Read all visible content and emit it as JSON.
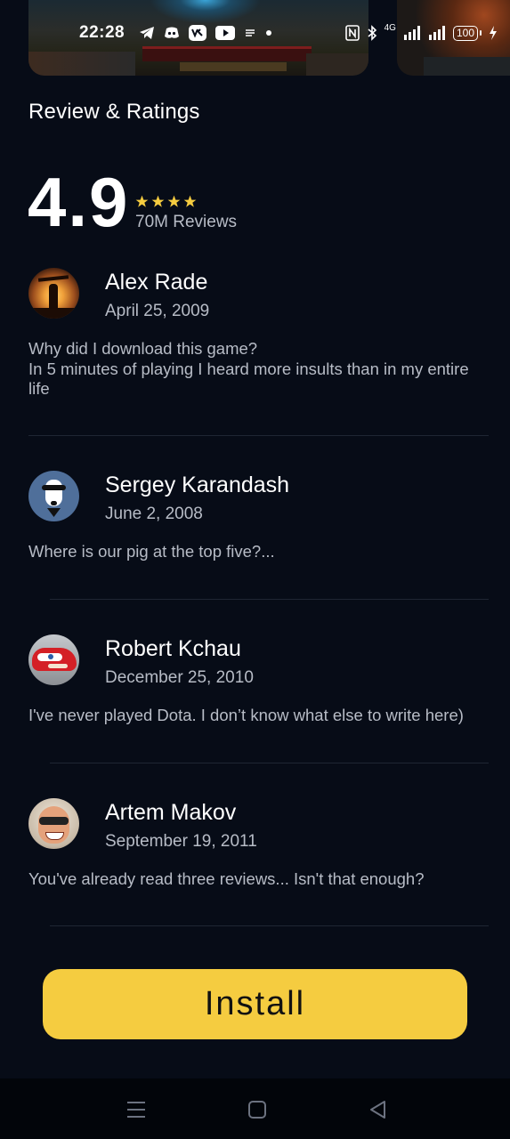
{
  "status_bar": {
    "time": "22:28",
    "network": "4G",
    "battery": "100"
  },
  "section": {
    "title": "Review & Ratings"
  },
  "rating": {
    "score": "4.9",
    "stars": 4,
    "reviews_count": "70M Reviews",
    "star_color": "#f5cc40"
  },
  "reviews": [
    {
      "name": "Alex Rade",
      "date": "April 25, 2009",
      "text_line1": "Why did I download this game?",
      "text_line2": "In 5 minutes of playing I heard more insults than in my entire life"
    },
    {
      "name": "Sergey Karandash",
      "date": "June 2, 2008",
      "text": "Where is our pig at the top five?..."
    },
    {
      "name": "Robert Kchau",
      "date": "December 25, 2010",
      "text": "I've never played Dota. I don’t know what else to write here)"
    },
    {
      "name": "Artem Makov",
      "date": "September 19, 2011",
      "text": "You've already read three reviews... Isn't that enough?"
    }
  ],
  "install": {
    "label": "Install",
    "color": "#f5cc40"
  },
  "navigation": {
    "icons": [
      "menu-icon",
      "home-icon",
      "back-icon"
    ]
  }
}
